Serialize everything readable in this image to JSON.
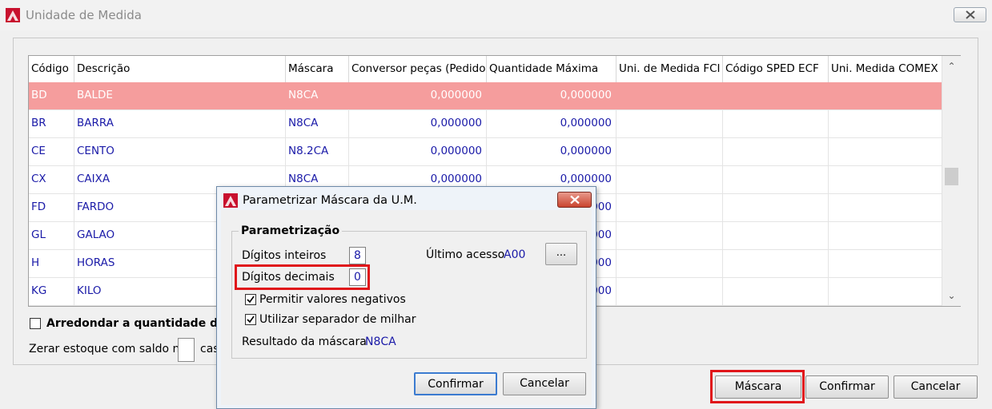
{
  "window": {
    "title": "Unidade de Medida",
    "close_label": "X"
  },
  "grid": {
    "headers": [
      "Código",
      "Descrição",
      "Máscara",
      "Conversor peças (Pedido)",
      "Quantidade Máxima",
      "Uni. de Medida FCI",
      "Código SPED ECF",
      "Uni. Medida COMEX"
    ],
    "rows": [
      [
        "BD",
        "BALDE",
        "N8CA",
        "0,000000",
        "0,000000"
      ],
      [
        "BR",
        "BARRA",
        "N8CA",
        "0,000000",
        "0,000000"
      ],
      [
        "CE",
        "CENTO",
        "N8.2CA",
        "0,000000",
        "0,000000"
      ],
      [
        "CX",
        "CAIXA",
        "N8CA",
        "0,000000",
        "0,000000"
      ],
      [
        "FD",
        "FARDO",
        "",
        "",
        "000"
      ],
      [
        "GL",
        "GALAO",
        "",
        "",
        "000"
      ],
      [
        "H",
        "HORAS",
        "",
        "",
        "000"
      ],
      [
        "KG",
        "KILO",
        "",
        "",
        "000"
      ]
    ],
    "selected_row_color": "#f59d9d"
  },
  "options": {
    "round_label": "Arredondar a quantidade da Eng",
    "zero_label": "Zerar estoque com saldo na",
    "zero_suffix": "cas"
  },
  "buttons": {
    "mascara": "Máscara",
    "confirmar": "Confirmar",
    "cancelar": "Cancelar"
  },
  "dialog": {
    "title": "Parametrizar Máscara da U.M.",
    "group_title": "Parametrização",
    "int_label": "Dígitos inteiros",
    "int_value": "8",
    "dec_label": "Dígitos decimais",
    "dec_value": "0",
    "last_access_label": "Último acesso",
    "last_access_value": "A00",
    "dots_label": "...",
    "neg_label": "Permitir valores negativos",
    "neg_checked": true,
    "sep_label": "Utilizar separador de milhar",
    "sep_checked": true,
    "result_label": "Resultado da máscara",
    "result_value": "N8CA",
    "confirm_label": "Confirmar",
    "cancel_label": "Cancelar"
  },
  "colors": {
    "highlight": "#e0151a",
    "value_text": "#1a1aa8"
  }
}
